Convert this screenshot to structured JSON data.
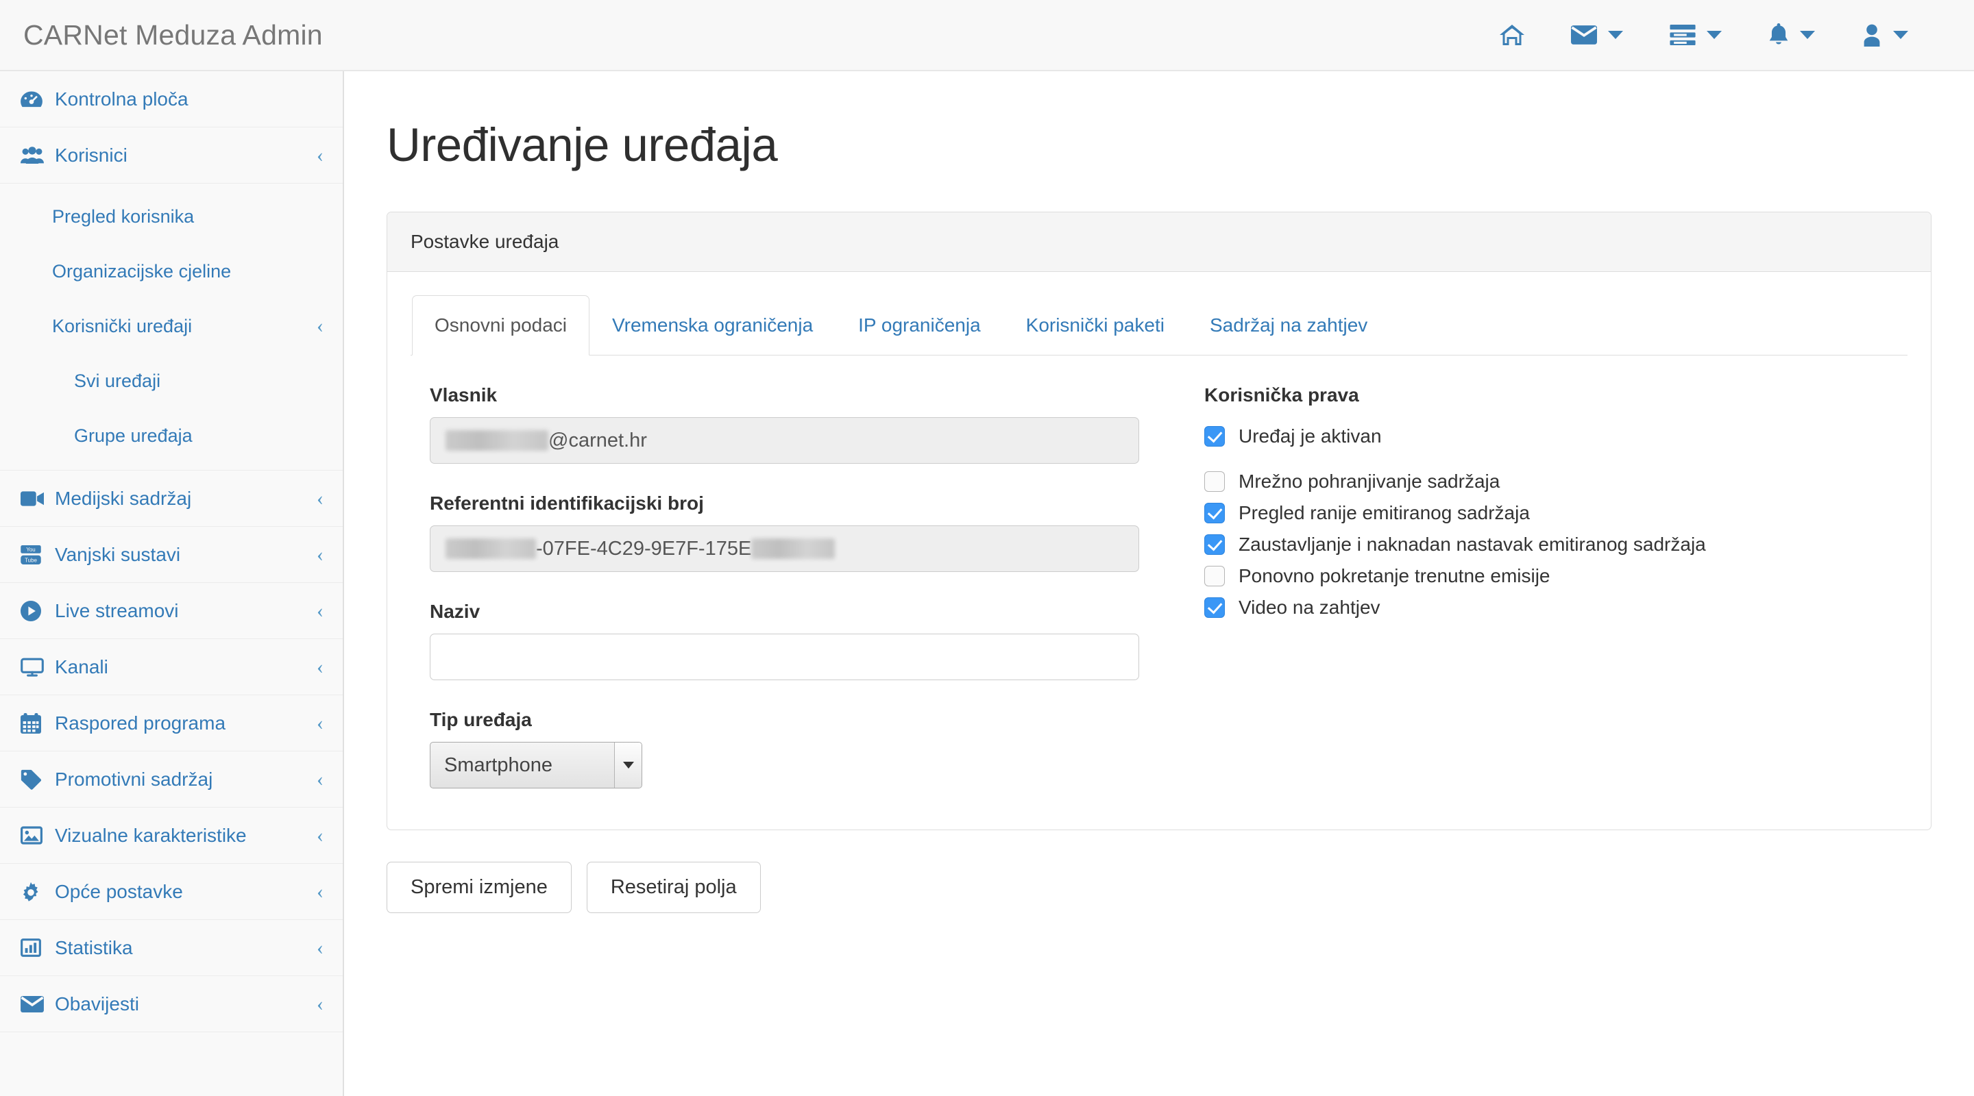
{
  "app": {
    "brand": "CARNet Meduza Admin"
  },
  "navbar": {
    "items": [
      {
        "icon": "home-icon",
        "caret": false
      },
      {
        "icon": "envelope-icon",
        "caret": true
      },
      {
        "icon": "tasks-icon",
        "caret": true
      },
      {
        "icon": "bell-icon",
        "caret": true
      },
      {
        "icon": "user-icon",
        "caret": true
      }
    ]
  },
  "sidebar": {
    "items": [
      {
        "label": "Kontrolna ploča",
        "icon": "dashboard-icon",
        "chevron": false
      },
      {
        "label": "Korisnici",
        "icon": "users-icon",
        "chevron": true
      },
      {
        "label": "Medijski sadržaj",
        "icon": "video-camera-icon",
        "chevron": true
      },
      {
        "label": "Vanjski sustavi",
        "icon": "youtube-icon",
        "chevron": true
      },
      {
        "label": "Live streamovi",
        "icon": "play-circle-icon",
        "chevron": true
      },
      {
        "label": "Kanali",
        "icon": "desktop-icon",
        "chevron": true
      },
      {
        "label": "Raspored programa",
        "icon": "calendar-icon",
        "chevron": true
      },
      {
        "label": "Promotivni sadržaj",
        "icon": "tag-icon",
        "chevron": true
      },
      {
        "label": "Vizualne karakteristike",
        "icon": "image-icon",
        "chevron": true
      },
      {
        "label": "Opće postavke",
        "icon": "gear-icon",
        "chevron": true
      },
      {
        "label": "Statistika",
        "icon": "bar-chart-icon",
        "chevron": true
      },
      {
        "label": "Obavijesti",
        "icon": "envelope-icon",
        "chevron": true
      }
    ],
    "korisnici_sub": [
      {
        "label": "Pregled korisnika",
        "chevron": false
      },
      {
        "label": "Organizacijske cjeline",
        "chevron": false
      },
      {
        "label": "Korisnički uređaji",
        "chevron": true
      }
    ],
    "uredaji_sub": [
      {
        "label": "Svi uređaji"
      },
      {
        "label": "Grupe uređaja"
      }
    ]
  },
  "main": {
    "page_title": "Uređivanje uređaja",
    "panel_header": "Postavke uređaja",
    "tabs": [
      {
        "label": "Osnovni podaci",
        "active": true
      },
      {
        "label": "Vremenska ograničenja",
        "active": false
      },
      {
        "label": "IP ograničenja",
        "active": false
      },
      {
        "label": "Korisnički paketi",
        "active": false
      },
      {
        "label": "Sadržaj na zahtjev",
        "active": false
      }
    ],
    "fields": {
      "vlasnik": {
        "label": "Vlasnik",
        "value": "@carnet.hr",
        "redacted_prefix": true,
        "readonly": true
      },
      "referentni": {
        "label": "Referentni identifikacijski broj",
        "value": "-07FE-4C29-9E7F-175E",
        "redacted_prefix": true,
        "redacted_suffix": true,
        "readonly": true
      },
      "naziv": {
        "label": "Naziv",
        "value": "",
        "placeholder": ""
      },
      "tip_uredaja": {
        "label": "Tip uređaja",
        "value": "Smartphone"
      }
    },
    "rights": {
      "title": "Korisnička prava",
      "items": [
        {
          "label": "Uređaj je aktivan",
          "checked": true,
          "gap_after": true
        },
        {
          "label": "Mrežno pohranjivanje sadržaja",
          "checked": false
        },
        {
          "label": "Pregled ranije emitiranog sadržaja",
          "checked": true
        },
        {
          "label": "Zaustavljanje i naknadan nastavak emitiranog sadržaja",
          "checked": true
        },
        {
          "label": "Ponovno pokretanje trenutne emisije",
          "checked": false
        },
        {
          "label": "Video na zahtjev",
          "checked": true
        }
      ]
    },
    "buttons": [
      {
        "label": "Spremi izmjene",
        "name": "save-changes-button"
      },
      {
        "label": "Resetiraj polja",
        "name": "reset-fields-button"
      }
    ]
  },
  "colors": {
    "link": "#337ab7",
    "icon": "#3c7fb5",
    "checkbox_on": "#3a97f6",
    "navbar_bg": "#f8f8f8",
    "sidebar_bg": "#f9f9f9"
  }
}
